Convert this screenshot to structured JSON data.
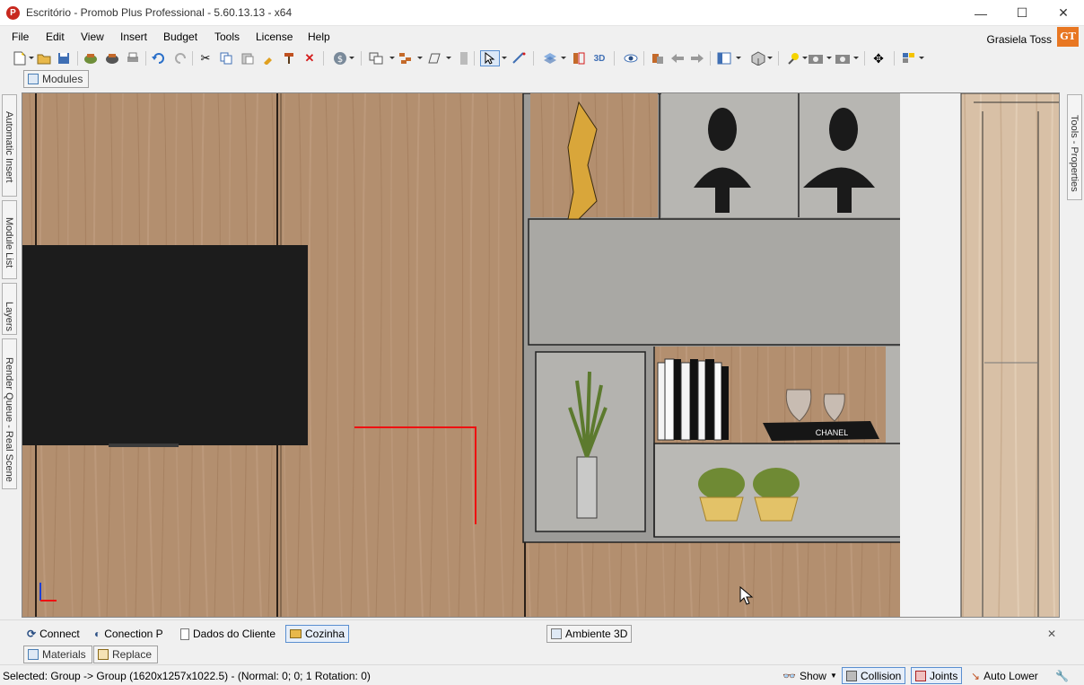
{
  "window": {
    "title": "Escritório - Promob Plus Professional - 5.60.13.13 - x64",
    "minimize": "—",
    "maximize": "☐",
    "close": "✕"
  },
  "menu": [
    "File",
    "Edit",
    "View",
    "Insert",
    "Budget",
    "Tools",
    "License",
    "Help"
  ],
  "user": {
    "name": "Grasiela Toss",
    "badge": "GT"
  },
  "top_tabs": {
    "modules": "Modules"
  },
  "left_side_tabs": [
    "Automatic Insert",
    "Module List",
    "Layers",
    "Render Queue - Real Scene"
  ],
  "right_side_tabs": [
    "Tools - Properties"
  ],
  "viewport": {
    "book_label": "CHANEL"
  },
  "bottom_tabs": {
    "connect": "Connect",
    "conection_p": "Conection P",
    "dados_cliente": "Dados do Cliente",
    "cozinha": "Cozinha",
    "ambiente_3d": "Ambiente 3D",
    "close": "✕"
  },
  "panel_tabs": {
    "materials": "Materials",
    "replace": "Replace"
  },
  "status": {
    "text": "Selected: Group -> Group (1620x1257x1022.5) - (Normal: 0; 0; 1 Rotation: 0)",
    "show": "Show",
    "collision": "Collision",
    "joints": "Joints",
    "auto_lower": "Auto Lower"
  },
  "colors": {
    "wood": "#b08d6d",
    "shelf_gray": "#a9a8a4",
    "tv": "#1c1c1c",
    "accent_blue": "#5a8fd0",
    "badge_orange": "#e87722"
  }
}
